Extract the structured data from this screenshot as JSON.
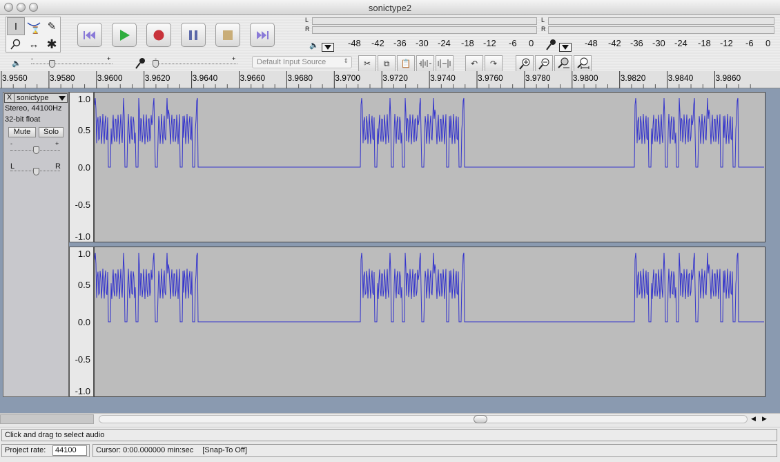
{
  "window": {
    "title": "sonictype2"
  },
  "tools": [
    {
      "name": "selection-tool-icon",
      "glyph": "I"
    },
    {
      "name": "envelope-tool-icon",
      "glyph": "⩘"
    },
    {
      "name": "draw-tool-icon",
      "glyph": "✎"
    },
    {
      "name": "zoom-tool-icon",
      "glyph": "⌕"
    },
    {
      "name": "timeshift-tool-icon",
      "glyph": "↔"
    },
    {
      "name": "multi-tool-icon",
      "glyph": "✱"
    }
  ],
  "meters": {
    "playback": {
      "left_label": "L",
      "right_label": "R",
      "scale": [
        "-48",
        "-42",
        "-36",
        "-30",
        "-24",
        "-18",
        "-12",
        "-6",
        "0"
      ]
    },
    "record": {
      "left_label": "L",
      "right_label": "R",
      "scale": [
        "-48",
        "-42",
        "-36",
        "-30",
        "-24",
        "-18",
        "-12",
        "-6",
        "0"
      ]
    }
  },
  "mixer": {
    "plus": "+",
    "minus": "-"
  },
  "input_source": {
    "value": "Default Input Source"
  },
  "ruler": {
    "ticks": [
      "3.9560",
      "3.9580",
      "3.9600",
      "3.9620",
      "3.9640",
      "3.9660",
      "3.9680",
      "3.9700",
      "3.9720",
      "3.9740",
      "3.9760",
      "3.9780",
      "3.9800",
      "3.9820",
      "3.9840",
      "3.9860"
    ]
  },
  "track": {
    "name": "sonictype",
    "close": "X",
    "format": "Stereo, 44100Hz",
    "bitdepth": "32-bit float",
    "mute_label": "Mute",
    "solo_label": "Solo",
    "gain_minus": "-",
    "gain_plus": "+",
    "pan_left": "L",
    "pan_right": "R"
  },
  "yaxis": [
    "1.0",
    "0.5",
    "0.0",
    "-0.5",
    "-1.0"
  ],
  "status": {
    "message": "Click and drag to select audio",
    "rate_label": "Project rate:",
    "rate_value": "44100",
    "cursor": "Cursor: 0:00.000000 min:sec",
    "snap": "[Snap-To Off]"
  },
  "colors": {
    "waveform": "#3333cc",
    "track_bg": "#bcbcbc"
  }
}
